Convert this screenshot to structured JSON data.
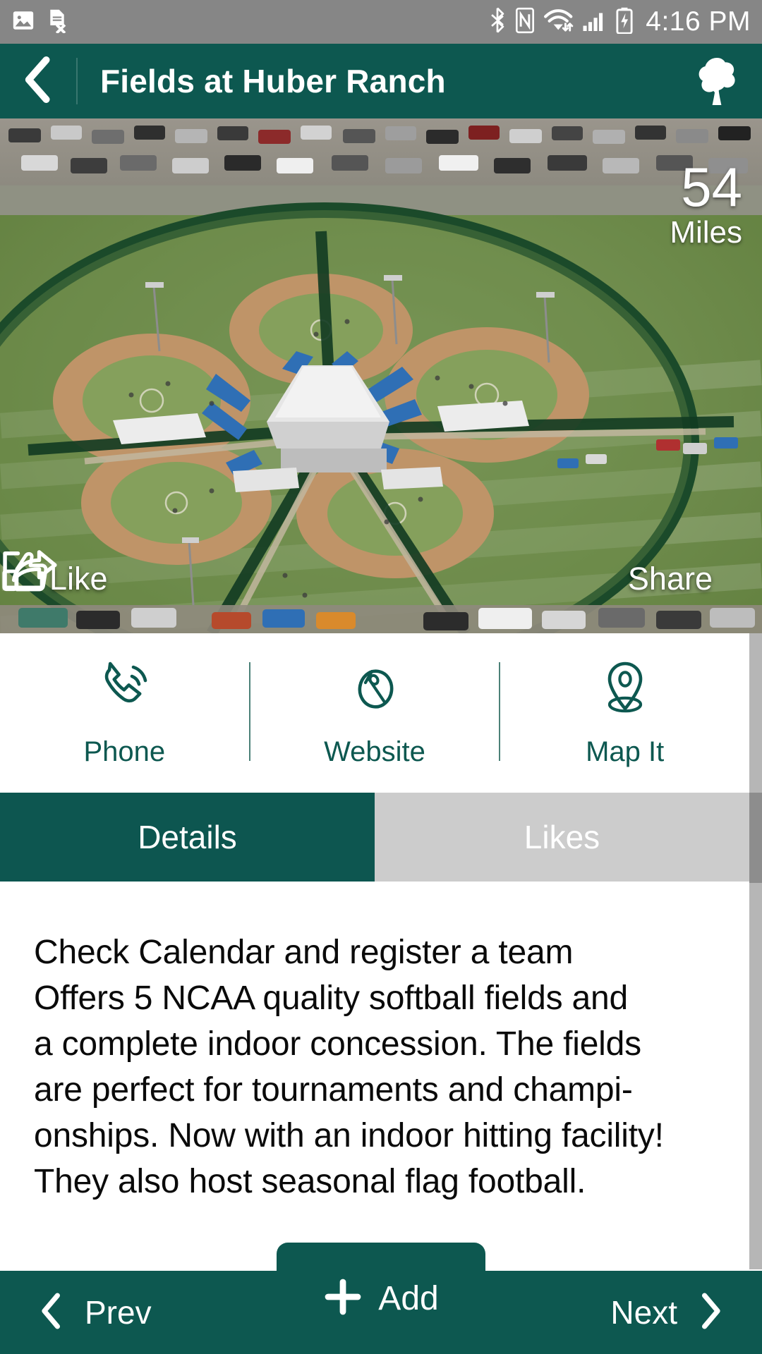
{
  "status_bar": {
    "time": "4:16 PM",
    "left_icons": [
      "image-icon",
      "sim-card-error-icon"
    ],
    "right_icons": [
      "bluetooth-icon",
      "nfc-icon",
      "wifi-icon",
      "cellular-signal-icon",
      "battery-charging-icon"
    ],
    "background_color": "#868686"
  },
  "header": {
    "title": "Fields at Huber Ranch",
    "back_icon": "chevron-left-icon",
    "logo_icon": "tree-logo-icon",
    "background_color": "#0d5850"
  },
  "photo": {
    "alt": "aerial-view-of-softball-complex",
    "distance_value": "54",
    "distance_unit": "Miles",
    "like_label": "Like",
    "like_icon": "thumbs-up-icon",
    "share_label": "Share",
    "share_icon": "share-arrow-icon"
  },
  "contact_actions": [
    {
      "label": "Phone",
      "icon": "phone-call-icon"
    },
    {
      "label": "Website",
      "icon": "computer-mouse-icon"
    },
    {
      "label": "Map It",
      "icon": "map-pin-icon"
    }
  ],
  "tabs": [
    {
      "label": "Details",
      "active": true,
      "background_color": "#0d5650"
    },
    {
      "label": "Likes",
      "active": false,
      "background_color": "#cccccc"
    }
  ],
  "details": {
    "text": "Check Calendar and register a team\nOffers 5 NCAA quality softball fields and\na complete indoor concession. The fields\nare perfect for tournaments and champi-\nonships. Now with an indoor hitting facility!\nThey also host seasonal flag football."
  },
  "bottom_nav": {
    "prev_label": "Prev",
    "prev_icon": "chevron-left-icon",
    "add_label": "Add",
    "add_icon": "plus-icon",
    "next_label": "Next",
    "next_icon": "chevron-right-icon",
    "background_color": "#0d5850"
  },
  "theme": {
    "accent_teal": "#0d5850",
    "tab_active": "#0d5650",
    "tab_inactive": "#cccccc",
    "status_gray": "#868686",
    "scrollbar_track": "#b6b6b6",
    "scrollbar_thumb": "#8d8d8d"
  }
}
